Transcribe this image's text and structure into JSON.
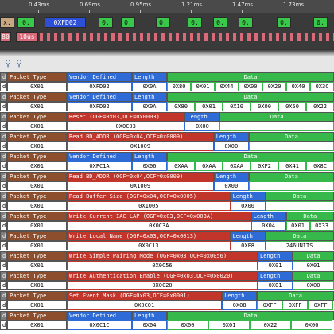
{
  "waveform": {
    "ticks": [
      "0.43ms",
      "0.69ms",
      "0.95ms",
      "1.21ms",
      "1.47ms",
      "1.73ms"
    ],
    "lane1": [
      "x.",
      "0.",
      "0XFD02",
      "0.",
      "0.",
      "0.",
      "0.",
      "0.",
      "0.",
      "0.",
      "0."
    ],
    "lane2": [
      "80",
      "10us"
    ]
  },
  "toolbar": {
    "icons": [
      "binoculars-icon",
      "binoculars-alt-icon"
    ]
  },
  "labels": {
    "packet_type": "Packet Type",
    "length": "Length",
    "data": "Data",
    "vendor": "Vendor Defined",
    "truncated_d": "d"
  },
  "packets": [
    {
      "pt": "0X01",
      "cmd": "Vendor Defined",
      "opcode": "0XFD02",
      "len": "0X0A",
      "data": [
        "0X80",
        "0X01",
        "0X44",
        "0X00",
        "0X20",
        "0X40",
        "0X3C"
      ]
    },
    {
      "pt": "0X01",
      "cmd": "Vendor Defined",
      "opcode": "0XFD02",
      "len": "0X0A",
      "data": [
        "0X80",
        "0X01",
        "0X10",
        "0X00",
        "0X50",
        "0X22"
      ]
    },
    {
      "pt": "0X01",
      "cmd": "Reset (OGF=0x03,OCF=0x0003)",
      "opcode": "0X0C03",
      "len": "0X00",
      "data": []
    },
    {
      "pt": "0X01",
      "cmd": "Read BD_ADDR (OGF=0x04,OCF=0x0009)",
      "opcode": "0X1009",
      "len": "0X00",
      "data": []
    },
    {
      "pt": "0X01",
      "cmd": "Vendor Defined",
      "opcode": "0XFC1A",
      "len": "0X06",
      "data": [
        "0XAA",
        "0XAA",
        "0XAA",
        "0XF2",
        "0X41",
        "0X8C"
      ]
    },
    {
      "pt": "0X01",
      "cmd": "Read BD_ADDR (OGF=0x04,OCF=0x0009)",
      "opcode": "0X1009",
      "len": "0X00",
      "data": []
    },
    {
      "pt": "0X01",
      "cmd": "Read Buffer Size (OGF=0x04,OCF=0x0005)",
      "opcode": "0X1005",
      "len": "0X00",
      "data": []
    },
    {
      "pt": "0X01",
      "cmd": "Write Current IAC LAP (OGF=0x03,OCF=0x003A)",
      "opcode": "0X0C3A",
      "len": "0X04",
      "data": [
        "0X01",
        "0X33"
      ]
    },
    {
      "pt": "0X01",
      "cmd": "Write Local Name (OGF=0x03,OCF=0x0013)",
      "opcode": "0X0C13",
      "len": "0XF8",
      "data": [
        "246UNITS"
      ]
    },
    {
      "pt": "0X01",
      "cmd": "Write Simple Pairing Mode (OGF=0x03,OCF=0x0056)",
      "opcode": "0X0C56",
      "len": "0X01",
      "data": [
        "0X01"
      ]
    },
    {
      "pt": "0X01",
      "cmd": "Write Authentication Enable (OGF=0x03,OCF=0x0020)",
      "opcode": "0X0C20",
      "len": "0X01",
      "data": [
        "0X00"
      ]
    },
    {
      "pt": "0X01",
      "cmd": "Set Event Mask (OGF=0x03,OCF=0x0001)",
      "opcode": "0X0C01",
      "len": "0X08",
      "data": [
        "0XFF",
        "0XFF",
        "0XFF"
      ]
    },
    {
      "pt": "0X01",
      "cmd": "Vendor Defined",
      "opcode": "0X0C1C",
      "len": "0X04",
      "data": [
        "0X00",
        "0X01",
        "0X22",
        "0X00"
      ]
    }
  ]
}
